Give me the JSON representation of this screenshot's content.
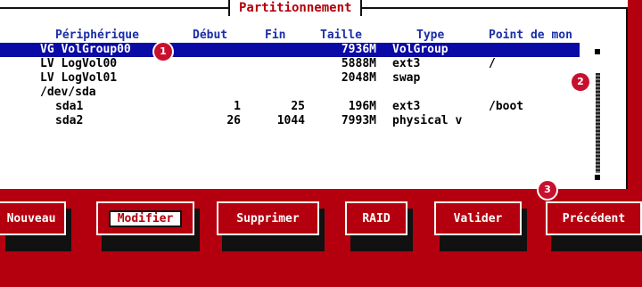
{
  "dialog": {
    "title": "Partitionnement"
  },
  "table": {
    "headers": {
      "device": "Périphérique",
      "start": "Début",
      "end": "Fin",
      "size": "Taille",
      "type": "Type",
      "mount": "Point de mon"
    },
    "rows": [
      {
        "device": "VG VolGroup00",
        "start": "",
        "end": "",
        "size": "7936M",
        "type": "VolGroup",
        "mount": ""
      },
      {
        "device": "LV LogVol00",
        "start": "",
        "end": "",
        "size": "5888M",
        "type": "ext3",
        "mount": "/"
      },
      {
        "device": "LV LogVol01",
        "start": "",
        "end": "",
        "size": "2048M",
        "type": "swap",
        "mount": ""
      },
      {
        "device": "/dev/sda",
        "start": "",
        "end": "",
        "size": "",
        "type": "",
        "mount": ""
      },
      {
        "device": "sda1",
        "start": "1",
        "end": "25",
        "size": "196M",
        "type": "ext3",
        "mount": "/boot"
      },
      {
        "device": "sda2",
        "start": "26",
        "end": "1044",
        "size": "7993M",
        "type": "physical v",
        "mount": ""
      }
    ]
  },
  "badges": [
    "1",
    "2",
    "3"
  ],
  "buttons": {
    "new": "Nouveau",
    "edit": "Modifier",
    "delete": "Supprimer",
    "raid": "RAID",
    "ok": "Valider",
    "back": "Précédent"
  },
  "colors": {
    "background": "#b4000e",
    "header_text": "#1a2ea6",
    "selection": "#0a0aa6",
    "badge": "#c8102e"
  }
}
